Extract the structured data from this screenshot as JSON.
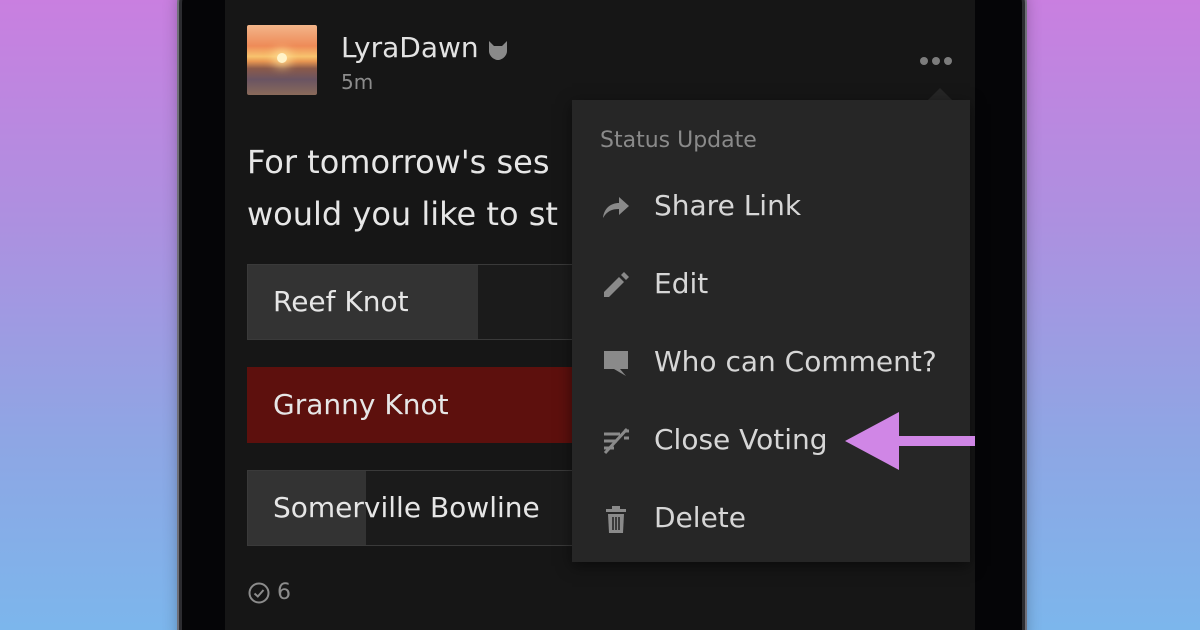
{
  "post": {
    "author": "LyraDawn",
    "time": "5m",
    "text_lines": [
      "For tomorrow's ses",
      "would you like to st"
    ]
  },
  "poll": {
    "options": [
      {
        "label": "Reef Knot",
        "fill_fraction": 0.7,
        "selected": false
      },
      {
        "label": "Granny Knot",
        "fill_fraction": 0.0,
        "selected": true
      },
      {
        "label": "Somerville Bowline",
        "fill_fraction": 0.36,
        "selected": false
      }
    ],
    "vote_count": "6"
  },
  "menu": {
    "header": "Status Update",
    "items": [
      {
        "label": "Share Link",
        "icon": "share-icon"
      },
      {
        "label": "Edit",
        "icon": "pencil-icon"
      },
      {
        "label": "Who can Comment?",
        "icon": "comment-icon"
      },
      {
        "label": "Close Voting",
        "icon": "close-voting-icon"
      },
      {
        "label": "Delete",
        "icon": "trash-icon"
      }
    ]
  },
  "colors": {
    "selected_option": "#5d100d",
    "highlight_arrow": "#d086e6",
    "menu_background": "#262626",
    "screen_background": "#161616"
  }
}
